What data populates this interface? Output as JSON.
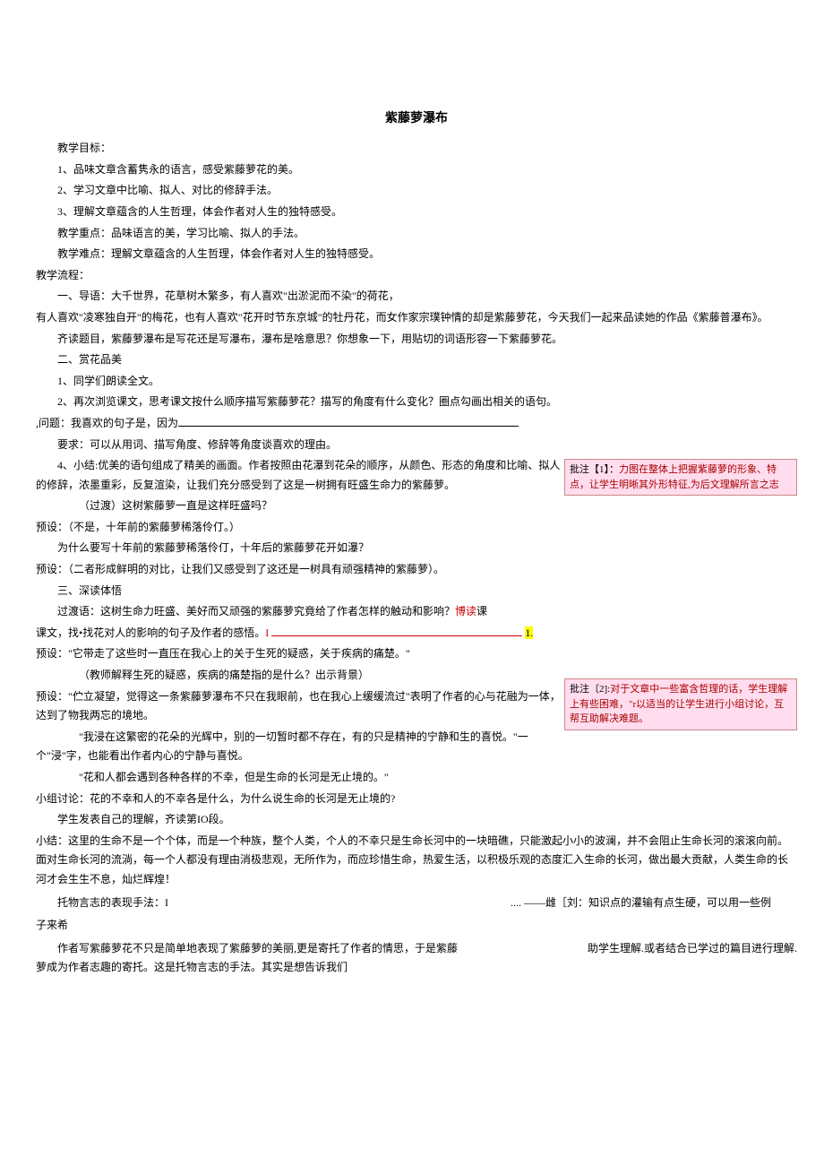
{
  "title": "紫藤萝瀑布",
  "goals_label": "教学目标：",
  "goal1": "1、品味文章含蓄隽永的语言，感受紫藤萝花的美。",
  "goal2": "2、学习文章中比喻、拟人、对比的修辞手法。",
  "goal3": "3、理解文章蕴含的人生哲理，体会作者对人生的独特感受。",
  "focus": "教学重点：品味语言的美，学习比喻、拟人的手法。",
  "difficulty": "教学难点：理解文章蕴含的人生哲理，体会作者对人生的独特感受。",
  "flow": "教学流程：",
  "intro_label": "一、导语：大千世界，花草树木繁多，有人喜欢\"出淤泥而不染\"的荷花，",
  "intro2": "有人喜欢\"凌寒独自开\"的梅花，也有人喜欢\"花开时节东京城\"的牡丹花，而女作家宗璞钟情的却是紫藤萝花，今天我们一起来品读她的作品《紫藤普瀑布》。",
  "qidu": "齐读题目，紫藤萝瀑布是写花还是写瀑布，瀑布是啥意思？你想象一下，用贴切的词语形容一下紫藤萝花。",
  "sec2": "二、赏花品美",
  "s2_1": "1、同学们朗读全文。",
  "s2_2": "2、再次浏览课文，思考课文按什么顺序描写紫藤萝花？描写的角度有什么变化？圈点勾画出相关的语句。",
  "s2_q": ",问题：我喜欢的句子是，因为",
  "s2_req": "要求：可以从用词、描写角度、修辞等角度谈喜欢的理由。",
  "s2_4a": "4、小结:优美的语句组成了精美的画面。作者按照由花瀑到花朵的顺序，从颜色、形态的角度和比喻、拟人的修辞，浓墨重彩，反复渲染，让我们充分感受到了这是一树拥有旺盛生命力的紫藤萝。",
  "trans1": "（过渡）这树紫藤萝一直是这样旺盛吗？",
  "preset1": "预设：（不是，十年前的紫藤萝稀落伶仃。）",
  "q_ten": "为什么要写十年前的紫藤萝稀落伶仃，十年后的紫藤萝花开如瀑？",
  "preset2": "预设：（二者形成鲜明的对比，让我们又感受到了这还是一树具有顽强精神的紫藤萝）。",
  "sec3": "三、深读体悟",
  "trans2a": "过渡语：这树生命力旺盛、美好而又顽强的紫藤萝究竟给了作者怎样的触动和影响？",
  "trans2b": "博读",
  "trans2c": "课文，找•找花对人的影响的句子及作者的感悟。",
  "bang": "1.",
  "preset3": "预设：\"它带走了这些时一直压在我心上的关于生死的疑惑，关于疾病的痛楚。\"",
  "teacher": "（教师解释生死的疑惑，疾病的痛楚指的是什么？出示背景）",
  "preset4": "预设：\"伫立凝望，觉得这一条紫藤萝瀑布不只在我眼前，也在我心上缓缓流过\"表明了作者的心与花融为一体，达到了物我两忘的境地。",
  "quote1": "\"我浸在这繁密的花朵的光辉中，别的一切暂时都不存在，有的只是精神的宁静和生的喜悦。\"一个\"浸\"字，也能看出作者内心的宁静与喜悦。",
  "quote2": "\"花和人都会遇到各种各样的不幸，但是生命的长河是无止境的。\"",
  "discuss": "小组讨论：花的不幸和人的不幸各是什么，为什么说生命的长河是无止境的?",
  "student": "学生发表自己的理解，齐读第IO段。",
  "summary": "小结：这里的生命不是一个个体，而是一个种族，整个人类，个人的不幸只是生命长河中的一块暗礁，只能激起小小的波澜，并不会阻止生命长河的滚滚向前。面对生命长河的流淌，每一个人都没有理由消极悲观，无所作为，而应珍惜生命，热爱生活，以积极乐观的态度汇入生命的长河，做出最大贡献，人类生命的长河才会生生不息，灿烂辉煌！",
  "tuowu": "托物言志的表现手法：I",
  "dots_liu": ".... ——雌［刘：知识点的灌输有点生硬，可以用一些例",
  "zilaixi": "子来希",
  "last1": "作者写紫藤萝花不只是简单地表现了紫藤萝的美丽,更是寄托了作者的情思，于是紫藤萝成为作者志趣的寄托。这是托物言志的手法。其实是想告诉我们",
  "last_help": "助学生理解.或者结合已学过的篇目进行理解.",
  "annot1_label": "批注【1】：",
  "annot1_text": "力图在整体上把握紫藤萝的形象、特点，让学生明晰其外形特征,为后文理解所言之志",
  "annot2_label": "批注〔2]:",
  "annot2_text": "对于文章中一些富含哲理的话，学生理解上有些困难，\"r以适当的让学生进行小组讨论，互帮互助解决难题。"
}
